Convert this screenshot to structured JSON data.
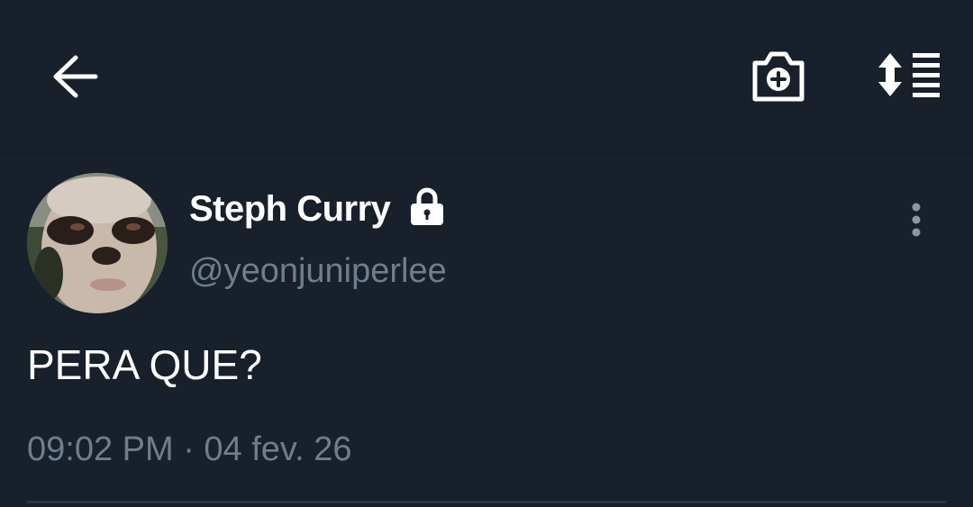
{
  "topbar": {
    "back_icon": "arrow-left-icon",
    "camera_icon": "camera-plus-icon",
    "sort_icon": "sort-order-icon"
  },
  "tweet": {
    "display_name": "Steph Curry",
    "protected_icon": "lock-icon",
    "handle": "@yeonjuniperlee",
    "text": "PERA QUE?",
    "timestamp": "09:02 PM · 04 fev. 26",
    "more_icon": "more-vertical-icon"
  },
  "colors": {
    "background": "#17202b",
    "primary_text": "#ffffff",
    "secondary_text": "#6e7e8e",
    "divider": "#2a3542"
  }
}
